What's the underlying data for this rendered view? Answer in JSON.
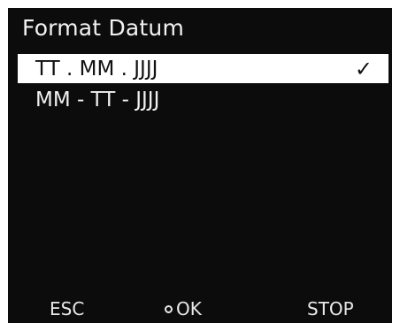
{
  "screen": {
    "title": "Format Datum"
  },
  "options": [
    {
      "label": "TT . MM . JJJJ",
      "selected": true,
      "check": "✓"
    },
    {
      "label": "MM - TT - JJJJ",
      "selected": false,
      "check": ""
    }
  ],
  "softkeys": {
    "esc": "ESC",
    "ok": "OK",
    "stop": "STOP"
  },
  "colors": {
    "screen_background": "#0c0c0c",
    "selected_background": "#ffffff",
    "text": "#ffffff",
    "selected_text": "#111111"
  },
  "icons": {
    "selected_marker": "check-icon",
    "ok_button": "circle-icon"
  }
}
